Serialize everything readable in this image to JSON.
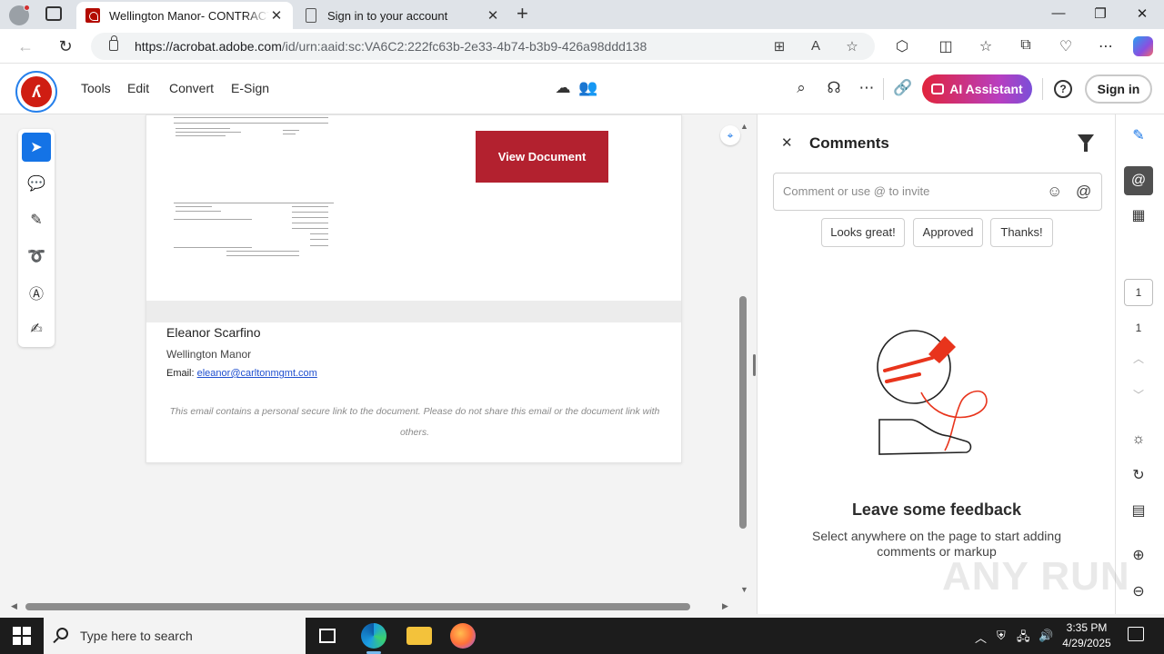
{
  "browser": {
    "tabs": [
      {
        "title": "Wellington Manor- CONTRACT F",
        "active": true
      },
      {
        "title": "Sign in to your account",
        "active": false
      }
    ],
    "url_host": "https://acrobat.adobe.com",
    "url_path": "/id/urn:aaid:sc:VA6C2:222fc63b-2e33-4b74-b3b9-426a98ddd138"
  },
  "app": {
    "menu": [
      "Tools",
      "Edit",
      "Convert",
      "E-Sign"
    ],
    "ai_label": "AI Assistant",
    "signin_label": "Sign in",
    "help_label": "?"
  },
  "document": {
    "view_button": "View Document",
    "sender_name": "Eleanor Scarfino",
    "company": "Wellington Manor",
    "email_label": "Email:",
    "email": "eleanor@carltonmgmt.com",
    "disclaimer": "This email contains a personal secure link to the document. Please do not share this email or the document link with others."
  },
  "comments": {
    "title": "Comments",
    "placeholder": "Comment or use @ to invite",
    "quick_replies": [
      "Looks great!",
      "Approved",
      "Thanks!"
    ],
    "empty_title": "Leave some feedback",
    "empty_text": "Select anywhere on the page to start adding comments or markup"
  },
  "pager": {
    "current": "1",
    "total": "1"
  },
  "watermark": "ANY RUN",
  "taskbar": {
    "search_placeholder": "Type here to search",
    "time": "3:35 PM",
    "date": "4/29/2025"
  }
}
